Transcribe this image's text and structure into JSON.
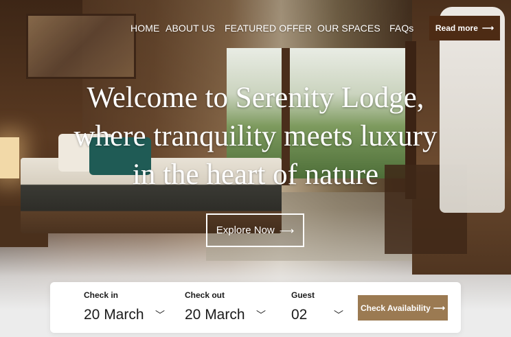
{
  "nav": {
    "items": [
      {
        "label": "HOME"
      },
      {
        "label": "ABOUT US"
      },
      {
        "label": "FEATURED OFFER"
      },
      {
        "label": "OUR SPACES"
      },
      {
        "label": "FAQs"
      }
    ],
    "read_more_label": "Read more",
    "arrow_icon": "arrow-right-icon"
  },
  "hero": {
    "headline_lines": [
      "Welcome to Serenity Lodge,",
      "where tranquility meets luxury",
      "in the heart of nature"
    ],
    "explore_label": "Explore Now"
  },
  "booking": {
    "check_in": {
      "label": "Check in",
      "value": "20 March"
    },
    "check_out": {
      "label": "Check out",
      "value": "20 March"
    },
    "guest": {
      "label": "Guest",
      "value": "02"
    },
    "button_label": "Check Availability",
    "chevron_icon": "chevron-down-icon"
  },
  "colors": {
    "read_more_bg": "#4d2b14",
    "accent_button": "#9b7a52",
    "text_white": "#ffffff",
    "text_dark": "#1a1a1a"
  },
  "glyphs": {
    "arrow": "⟶",
    "chevron": "﹀"
  }
}
